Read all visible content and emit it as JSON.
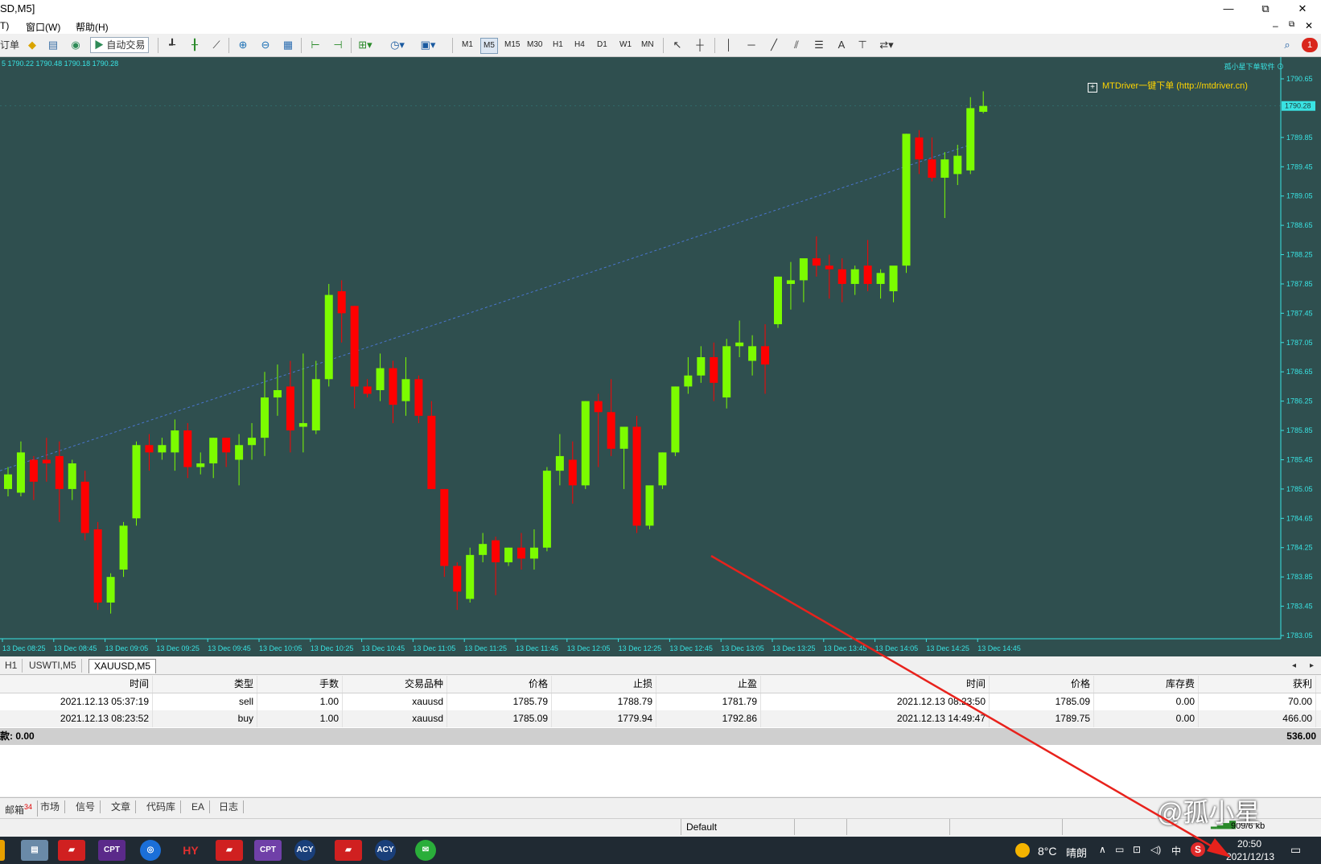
{
  "window": {
    "title": "SD,M5]",
    "buttons": {
      "minimize": "—",
      "restore": "⧉",
      "close": "✕"
    }
  },
  "menu": {
    "items": [
      "T)",
      "窗口(W)",
      "帮助(H)"
    ],
    "mdi_buttons": [
      "–",
      "⧉",
      "✕"
    ]
  },
  "toolbar": {
    "order_label": "订单",
    "autotrade_label": "自动交易",
    "timeframes": [
      "M1",
      "M5",
      "M15",
      "M30",
      "H1",
      "H4",
      "D1",
      "W1",
      "MN"
    ],
    "active_timeframe": "M5",
    "text_tool": "A",
    "notification_count": "1"
  },
  "chart": {
    "ohlc_line": "5 1790.22 1790.48 1790.18 1790.28",
    "brand_text": "孤小星下单软件 ⊙",
    "mtdriver_label": "MTDriver一键下单 (http://mtdriver.cn)",
    "colors": {
      "background": "#2f4f4f",
      "bull": "#7cfc00",
      "bear": "#ff0000",
      "trend": "#4a76d0",
      "axis_text": "#39e3e3",
      "price_tag": "#39e3e3"
    }
  },
  "chart_data": {
    "type": "candlestick",
    "symbol": "XAUUSD",
    "timeframe": "M5",
    "y_ticks": [
      "1790.65",
      "1789.85",
      "1789.45",
      "1789.05",
      "1788.65",
      "1788.25",
      "1787.85",
      "1787.45",
      "1787.05",
      "1786.65",
      "1786.25",
      "1785.85",
      "1785.45",
      "1785.05",
      "1784.65",
      "1784.25",
      "1783.85",
      "1783.45",
      "1783.05"
    ],
    "ylim": [
      1783.05,
      1790.65
    ],
    "current_price": "1790.28",
    "x_ticks": [
      "13 Dec 08:25",
      "13 Dec 08:45",
      "13 Dec 09:05",
      "13 Dec 09:25",
      "13 Dec 09:45",
      "13 Dec 10:05",
      "13 Dec 10:25",
      "13 Dec 10:45",
      "13 Dec 11:05",
      "13 Dec 11:25",
      "13 Dec 11:45",
      "13 Dec 12:05",
      "13 Dec 12:25",
      "13 Dec 12:45",
      "13 Dec 13:05",
      "13 Dec 13:25",
      "13 Dec 13:45",
      "13 Dec 14:05",
      "13 Dec 14:25",
      "13 Dec 14:45"
    ],
    "candles": [
      {
        "o": 1785.05,
        "h": 1785.35,
        "l": 1784.95,
        "c": 1785.25
      },
      {
        "o": 1785.0,
        "h": 1785.7,
        "l": 1784.95,
        "c": 1785.55
      },
      {
        "o": 1785.45,
        "h": 1785.5,
        "l": 1784.9,
        "c": 1785.15
      },
      {
        "o": 1785.45,
        "h": 1785.75,
        "l": 1785.15,
        "c": 1785.4
      },
      {
        "o": 1785.5,
        "h": 1785.7,
        "l": 1784.6,
        "c": 1785.05
      },
      {
        "o": 1785.05,
        "h": 1785.45,
        "l": 1784.9,
        "c": 1785.4
      },
      {
        "o": 1785.15,
        "h": 1785.3,
        "l": 1784.35,
        "c": 1784.45
      },
      {
        "o": 1784.5,
        "h": 1784.6,
        "l": 1783.4,
        "c": 1783.5
      },
      {
        "o": 1783.5,
        "h": 1783.9,
        "l": 1783.35,
        "c": 1783.85
      },
      {
        "o": 1783.95,
        "h": 1784.6,
        "l": 1783.85,
        "c": 1784.55
      },
      {
        "o": 1784.65,
        "h": 1785.7,
        "l": 1784.55,
        "c": 1785.65
      },
      {
        "o": 1785.65,
        "h": 1785.8,
        "l": 1785.3,
        "c": 1785.55
      },
      {
        "o": 1785.55,
        "h": 1785.75,
        "l": 1785.45,
        "c": 1785.65
      },
      {
        "o": 1785.55,
        "h": 1786.0,
        "l": 1785.3,
        "c": 1785.85
      },
      {
        "o": 1785.85,
        "h": 1785.95,
        "l": 1785.2,
        "c": 1785.35
      },
      {
        "o": 1785.35,
        "h": 1785.55,
        "l": 1785.25,
        "c": 1785.4
      },
      {
        "o": 1785.4,
        "h": 1785.75,
        "l": 1785.2,
        "c": 1785.75
      },
      {
        "o": 1785.75,
        "h": 1785.75,
        "l": 1785.35,
        "c": 1785.55
      },
      {
        "o": 1785.45,
        "h": 1785.8,
        "l": 1785.1,
        "c": 1785.65
      },
      {
        "o": 1785.65,
        "h": 1785.95,
        "l": 1785.45,
        "c": 1785.75
      },
      {
        "o": 1785.75,
        "h": 1786.65,
        "l": 1785.5,
        "c": 1786.3
      },
      {
        "o": 1786.3,
        "h": 1786.75,
        "l": 1786.05,
        "c": 1786.4
      },
      {
        "o": 1786.45,
        "h": 1786.8,
        "l": 1785.55,
        "c": 1785.85
      },
      {
        "o": 1785.9,
        "h": 1786.9,
        "l": 1785.55,
        "c": 1785.95
      },
      {
        "o": 1785.85,
        "h": 1786.8,
        "l": 1785.8,
        "c": 1786.55
      },
      {
        "o": 1786.55,
        "h": 1787.85,
        "l": 1786.45,
        "c": 1787.7
      },
      {
        "o": 1787.75,
        "h": 1787.9,
        "l": 1787.05,
        "c": 1787.45
      },
      {
        "o": 1787.55,
        "h": 1787.55,
        "l": 1786.15,
        "c": 1786.45
      },
      {
        "o": 1786.45,
        "h": 1786.55,
        "l": 1786.3,
        "c": 1786.35
      },
      {
        "o": 1786.4,
        "h": 1786.9,
        "l": 1786.25,
        "c": 1786.7
      },
      {
        "o": 1786.7,
        "h": 1786.8,
        "l": 1785.95,
        "c": 1786.2
      },
      {
        "o": 1786.25,
        "h": 1786.85,
        "l": 1786.05,
        "c": 1786.55
      },
      {
        "o": 1786.55,
        "h": 1786.6,
        "l": 1785.95,
        "c": 1786.05
      },
      {
        "o": 1786.05,
        "h": 1786.25,
        "l": 1785.05,
        "c": 1785.05
      },
      {
        "o": 1785.05,
        "h": 1785.05,
        "l": 1783.85,
        "c": 1784.0
      },
      {
        "o": 1784.0,
        "h": 1784.05,
        "l": 1783.4,
        "c": 1783.65
      },
      {
        "o": 1783.55,
        "h": 1784.25,
        "l": 1783.5,
        "c": 1784.15
      },
      {
        "o": 1784.15,
        "h": 1784.45,
        "l": 1784.05,
        "c": 1784.3
      },
      {
        "o": 1784.35,
        "h": 1784.4,
        "l": 1783.6,
        "c": 1784.05
      },
      {
        "o": 1784.05,
        "h": 1784.25,
        "l": 1784.0,
        "c": 1784.25
      },
      {
        "o": 1784.25,
        "h": 1784.45,
        "l": 1783.95,
        "c": 1784.1
      },
      {
        "o": 1784.1,
        "h": 1784.5,
        "l": 1783.95,
        "c": 1784.25
      },
      {
        "o": 1784.25,
        "h": 1785.35,
        "l": 1784.2,
        "c": 1785.3
      },
      {
        "o": 1785.3,
        "h": 1785.8,
        "l": 1785.1,
        "c": 1785.5
      },
      {
        "o": 1785.45,
        "h": 1785.7,
        "l": 1784.85,
        "c": 1785.1
      },
      {
        "o": 1785.1,
        "h": 1786.25,
        "l": 1785.05,
        "c": 1786.25
      },
      {
        "o": 1786.25,
        "h": 1786.35,
        "l": 1785.35,
        "c": 1786.1
      },
      {
        "o": 1786.1,
        "h": 1786.55,
        "l": 1785.5,
        "c": 1785.6
      },
      {
        "o": 1785.6,
        "h": 1785.7,
        "l": 1785.05,
        "c": 1785.9
      },
      {
        "o": 1785.9,
        "h": 1786.05,
        "l": 1784.45,
        "c": 1784.55
      },
      {
        "o": 1784.55,
        "h": 1784.95,
        "l": 1784.5,
        "c": 1785.1
      },
      {
        "o": 1785.1,
        "h": 1785.55,
        "l": 1785.05,
        "c": 1785.55
      },
      {
        "o": 1785.55,
        "h": 1786.45,
        "l": 1785.5,
        "c": 1786.45
      },
      {
        "o": 1786.45,
        "h": 1786.85,
        "l": 1786.35,
        "c": 1786.6
      },
      {
        "o": 1786.6,
        "h": 1787.0,
        "l": 1786.5,
        "c": 1786.85
      },
      {
        "o": 1786.85,
        "h": 1787.05,
        "l": 1786.25,
        "c": 1786.5
      },
      {
        "o": 1786.3,
        "h": 1787.1,
        "l": 1786.15,
        "c": 1787.0
      },
      {
        "o": 1787.0,
        "h": 1787.35,
        "l": 1786.85,
        "c": 1787.05
      },
      {
        "o": 1786.8,
        "h": 1787.15,
        "l": 1786.6,
        "c": 1787.0
      },
      {
        "o": 1787.0,
        "h": 1787.3,
        "l": 1786.35,
        "c": 1786.75
      },
      {
        "o": 1787.3,
        "h": 1787.95,
        "l": 1787.25,
        "c": 1787.95
      },
      {
        "o": 1787.85,
        "h": 1788.15,
        "l": 1787.5,
        "c": 1787.9
      },
      {
        "o": 1787.9,
        "h": 1788.15,
        "l": 1787.6,
        "c": 1788.2
      },
      {
        "o": 1788.2,
        "h": 1788.5,
        "l": 1787.95,
        "c": 1788.1
      },
      {
        "o": 1788.1,
        "h": 1788.25,
        "l": 1787.65,
        "c": 1788.05
      },
      {
        "o": 1788.05,
        "h": 1788.2,
        "l": 1787.6,
        "c": 1787.85
      },
      {
        "o": 1787.85,
        "h": 1788.1,
        "l": 1787.7,
        "c": 1788.05
      },
      {
        "o": 1788.1,
        "h": 1788.45,
        "l": 1787.75,
        "c": 1787.85
      },
      {
        "o": 1787.85,
        "h": 1788.05,
        "l": 1787.65,
        "c": 1788.0
      },
      {
        "o": 1787.75,
        "h": 1788.0,
        "l": 1787.6,
        "c": 1788.1
      },
      {
        "o": 1788.1,
        "h": 1789.9,
        "l": 1788.0,
        "c": 1789.9
      },
      {
        "o": 1789.85,
        "h": 1789.95,
        "l": 1789.35,
        "c": 1789.55
      },
      {
        "o": 1789.55,
        "h": 1789.85,
        "l": 1789.25,
        "c": 1789.3
      },
      {
        "o": 1789.3,
        "h": 1789.65,
        "l": 1788.75,
        "c": 1789.55
      },
      {
        "o": 1789.35,
        "h": 1789.75,
        "l": 1789.2,
        "c": 1789.6
      },
      {
        "o": 1789.4,
        "h": 1790.4,
        "l": 1789.35,
        "c": 1790.25
      },
      {
        "o": 1790.2,
        "h": 1790.48,
        "l": 1790.18,
        "c": 1790.28
      }
    ]
  },
  "chart_tabs": {
    "items": [
      "H1",
      "USWTI,M5",
      "XAUUSD,M5"
    ],
    "active": "XAUUSD,M5"
  },
  "trade_table": {
    "headers": [
      "时间",
      "类型",
      "手数",
      "交易品种",
      "价格",
      "止损",
      "止盈",
      "时间",
      "价格",
      "库存费",
      "获利"
    ],
    "rows": [
      [
        "2021.12.13 05:37:19",
        "sell",
        "1.00",
        "xauusd",
        "1785.79",
        "1788.79",
        "1781.79",
        "2021.12.13 08:23:50",
        "1785.09",
        "0.00",
        "70.00"
      ],
      [
        "2021.12.13 08:23:52",
        "buy",
        "1.00",
        "xauusd",
        "1785.09",
        "1779.94",
        "1792.86",
        "2021.12.13 14:49:47",
        "1789.75",
        "0.00",
        "466.00"
      ]
    ],
    "summary_label": "款: 0.00",
    "summary_total": "536.00"
  },
  "bottom_tabs": {
    "items": [
      "邮箱",
      "市场",
      "信号",
      "文章",
      "代码库",
      "EA",
      "日志"
    ],
    "mail_badge": "34"
  },
  "status_bar": {
    "profile": "Default",
    "traffic": "909/6 kb"
  },
  "taskbar": {
    "apps": [
      "CPT",
      "HY",
      "CPT",
      "ACY",
      "ACY"
    ],
    "weather_temp": "8°C",
    "weather_text": "晴朗",
    "ime": "中",
    "time": "20:50",
    "date": "2021/12/13",
    "watermark": "@孤小星"
  }
}
